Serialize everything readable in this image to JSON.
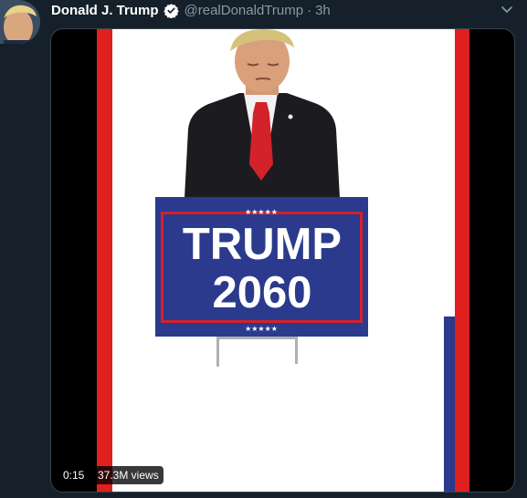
{
  "tweet": {
    "author_name": "Donald J. Trump",
    "handle": "@realDonaldTrump",
    "separator": "·",
    "time": "3h"
  },
  "video": {
    "duration": "0:15",
    "views": "37.3M views",
    "sign_line1": "TRUMP",
    "sign_line2": "2060",
    "sign_stars": "★★★★★"
  },
  "colors": {
    "background": "#15202b",
    "secondary_text": "#8899a6",
    "sign_blue": "#2b3a8c",
    "sign_red": "#d3222a",
    "frame_red": "#e0201f"
  },
  "icons": {
    "verified": "verified-badge-icon",
    "menu": "chevron-down-icon"
  }
}
